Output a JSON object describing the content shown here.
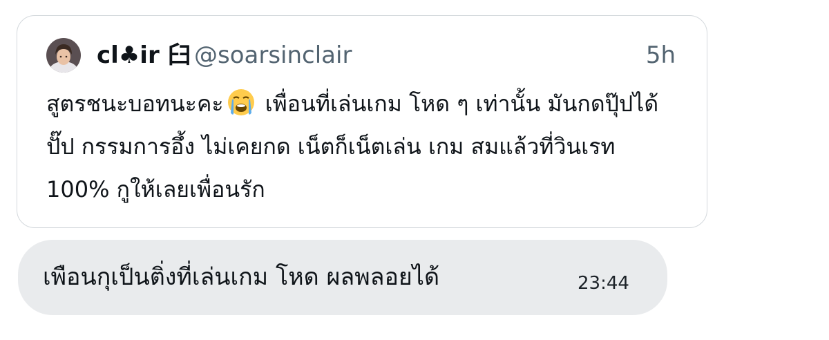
{
  "quoted_tweet": {
    "avatar_icon": "profile-photo-avatar",
    "author_name": "cl♣ir ⾅",
    "handle": "@soarsinclair",
    "time_ago": "5h",
    "text_before_emoji": "สูตรชนะบอทนะคะ",
    "emoji_icon": "loudly-crying-face-emoji",
    "text_after_emoji": " เพื่อนที่เล่นเกม โหด ๆ เท่านั้น มันกดปุ๊ปได้ปั๊ป กรรมการอึ้ง ไม่เคยกด เน็ตก็เน็ตเล่น เกม สมแล้วที่วินเรท 100% กูให้เลยเพื่อนรัก"
  },
  "reply_message": {
    "text": "เพือนกุเป็นติ่งที่เล่นเกม โหด ผลพลอยได้",
    "time": "23:44",
    "bubble_color": "#e9ebed"
  },
  "colors": {
    "primary_text": "#0f1419",
    "secondary_text": "#536471",
    "card_border": "#d3d8dc"
  }
}
